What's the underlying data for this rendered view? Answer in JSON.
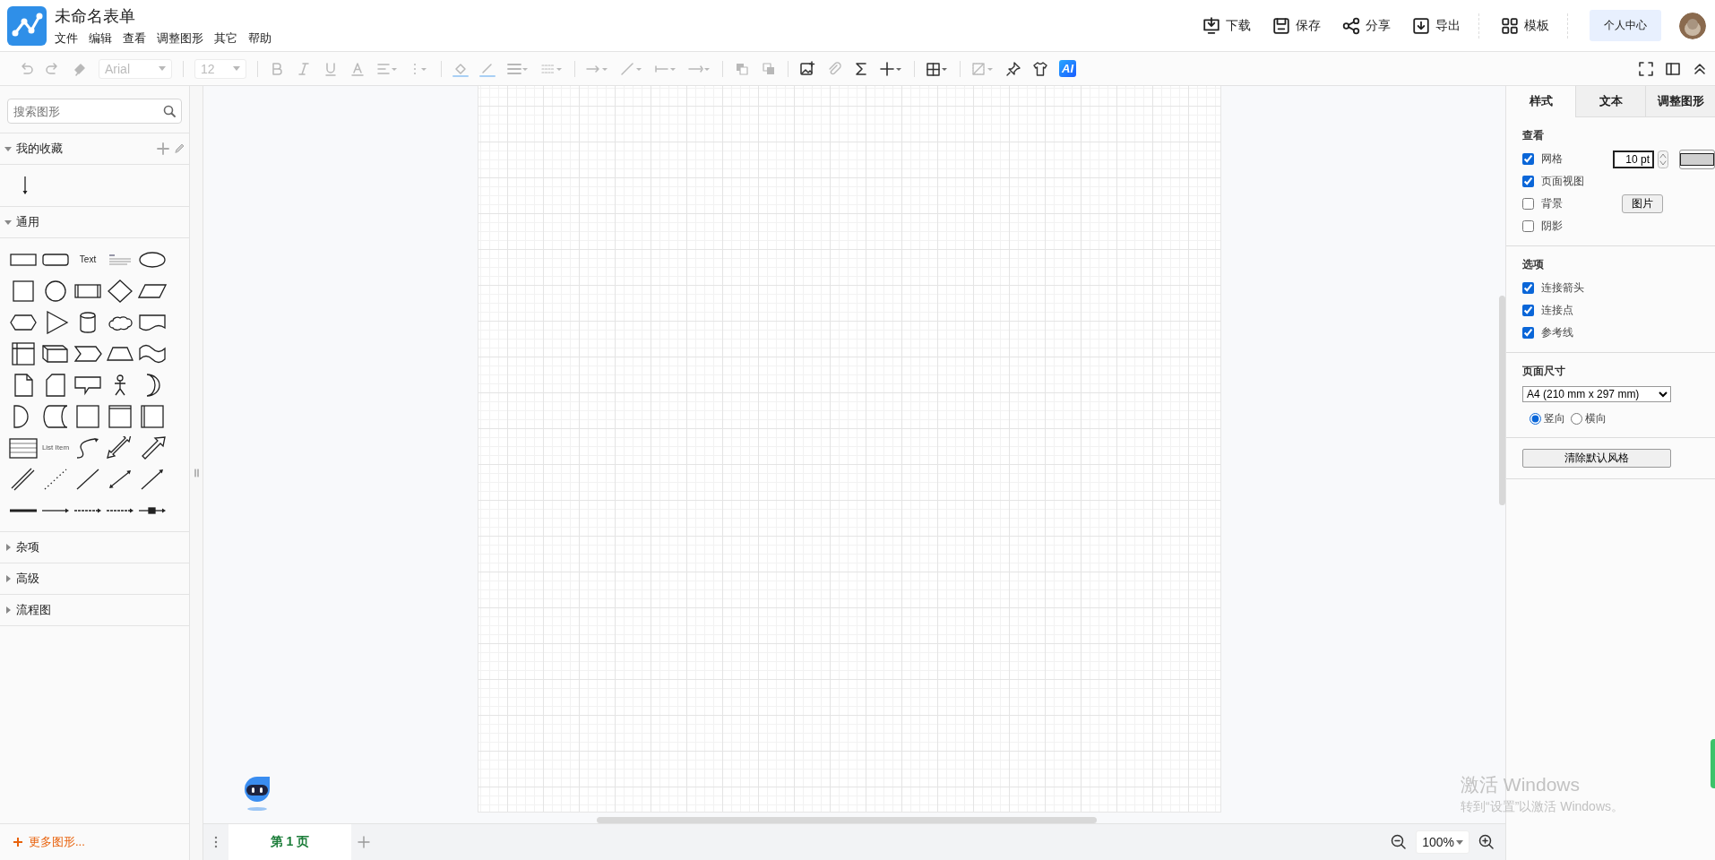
{
  "app": {
    "title": "未命名表单"
  },
  "menu": [
    "文件",
    "编辑",
    "查看",
    "调整图形",
    "其它",
    "帮助"
  ],
  "header_actions": [
    {
      "label": "下载",
      "kind": "download"
    },
    {
      "label": "保存",
      "kind": "save"
    },
    {
      "label": "分享",
      "kind": "share"
    },
    {
      "label": "导出",
      "kind": "export"
    },
    {
      "label": "模板",
      "kind": "template"
    }
  ],
  "account_button": "个人中心",
  "toolbar": {
    "font": {
      "value": "Arial",
      "disabled": true
    },
    "font_size": {
      "value": "12",
      "disabled": true
    },
    "ai_badge": "AI"
  },
  "sidebar": {
    "search": {
      "placeholder": "搜索图形"
    },
    "sections": [
      {
        "title": "我的收藏",
        "expanded": true,
        "kind": "favorites",
        "shapes": [
          {
            "kind": "down-arrow"
          }
        ]
      },
      {
        "title": "通用",
        "expanded": true,
        "kind": "library",
        "shapes": [
          {
            "kind": "rectangle"
          },
          {
            "kind": "rounded-rectangle"
          },
          {
            "kind": "text",
            "label": "Text"
          },
          {
            "kind": "textbox"
          },
          {
            "kind": "ellipse"
          },
          {
            "kind": "square"
          },
          {
            "kind": "circle"
          },
          {
            "kind": "process"
          },
          {
            "kind": "diamond"
          },
          {
            "kind": "parallelogram"
          },
          {
            "kind": "hexagon"
          },
          {
            "kind": "triangle"
          },
          {
            "kind": "cylinder"
          },
          {
            "kind": "cloud"
          },
          {
            "kind": "document"
          },
          {
            "kind": "internal-storage"
          },
          {
            "kind": "cube"
          },
          {
            "kind": "step"
          },
          {
            "kind": "trapezoid"
          },
          {
            "kind": "tape"
          },
          {
            "kind": "note"
          },
          {
            "kind": "card"
          },
          {
            "kind": "callout"
          },
          {
            "kind": "actor"
          },
          {
            "kind": "crescent"
          },
          {
            "kind": "delay"
          },
          {
            "kind": "data-storage"
          },
          {
            "kind": "container"
          },
          {
            "kind": "window"
          },
          {
            "kind": "swimlane"
          },
          {
            "kind": "list"
          },
          {
            "kind": "list-item",
            "label": "List Item"
          },
          {
            "kind": "curve"
          },
          {
            "kind": "double-arrow"
          },
          {
            "kind": "arrow"
          },
          {
            "kind": "double-line"
          },
          {
            "kind": "dotted-line"
          },
          {
            "kind": "line"
          },
          {
            "kind": "bidirectional-connector"
          },
          {
            "kind": "directional-connector"
          },
          {
            "kind": "thick-line"
          },
          {
            "kind": "connector"
          },
          {
            "kind": "dashed-connector"
          },
          {
            "kind": "dashed-connector"
          },
          {
            "kind": "connector-symbol"
          }
        ]
      },
      {
        "title": "杂项",
        "expanded": false,
        "kind": "library"
      },
      {
        "title": "高级",
        "expanded": false,
        "kind": "library"
      },
      {
        "title": "流程图",
        "expanded": false,
        "kind": "library"
      }
    ],
    "more_shapes": "更多图形..."
  },
  "pages": {
    "tabs": [
      {
        "label": "第 1 页",
        "selected": true
      }
    ]
  },
  "zoom": {
    "value": "100%"
  },
  "format_panel": {
    "tabs": [
      {
        "label": "样式",
        "selected": true
      },
      {
        "label": "文本",
        "selected": false
      },
      {
        "label": "调整图形",
        "selected": false
      }
    ],
    "view": {
      "title": "查看",
      "options": [
        {
          "label": "网格",
          "checked": true,
          "kind": "grid",
          "value": "10 pt"
        },
        {
          "label": "页面视图",
          "checked": true
        },
        {
          "label": "背景",
          "checked": false,
          "kind": "image",
          "button": "图片"
        },
        {
          "label": "阴影",
          "checked": false
        }
      ]
    },
    "options": {
      "title": "选项",
      "options": [
        {
          "label": "连接箭头",
          "checked": true
        },
        {
          "label": "连接点",
          "checked": true
        },
        {
          "label": "参考线",
          "checked": true
        }
      ]
    },
    "page_size": {
      "title": "页面尺寸",
      "value": "A4 (210 mm x 297 mm)",
      "orientation": [
        {
          "label": "竖向",
          "selected": true
        },
        {
          "label": "横向",
          "selected": false
        }
      ]
    },
    "reset_button": "清除默认风格"
  },
  "os_notice": {
    "title": "激活 Windows",
    "text": "转到“设置”以激活 Windows。"
  }
}
